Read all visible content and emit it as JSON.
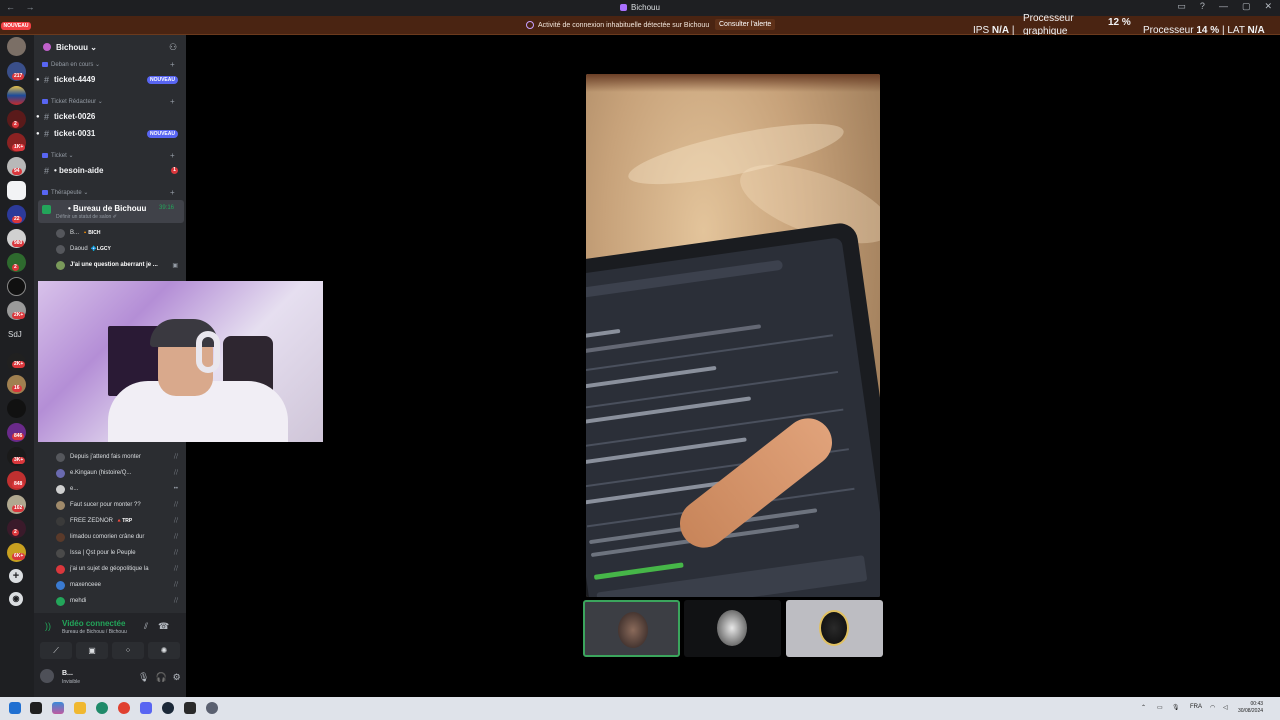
{
  "window": {
    "title": "Bichouu",
    "nav_arrows": "← →"
  },
  "alert": {
    "message": "Activité de connexion inhabituelle détectée sur Bichouu",
    "action": "Consulter l'alerte"
  },
  "overlay": {
    "ips_label": "IPS",
    "ips_value": "N/A",
    "gpu_label_1": "Processeur",
    "gpu_label_2": "graphique",
    "gpu_value": "12 %",
    "cpu_label": "Processeur",
    "cpu_value": "14 %",
    "lat_label": "LAT",
    "lat_value": "N/A",
    "sep": "|"
  },
  "rail": {
    "nouveau": "NOUVEAU",
    "sdj": "SdJ",
    "badges": [
      "217",
      "2",
      "1K+",
      "94",
      "22",
      "980",
      "2",
      "2K+",
      "2K+",
      "16",
      "846",
      "3K+",
      "848",
      "102",
      "2",
      "6K+"
    ]
  },
  "server": {
    "name": "Bichouu ⌄"
  },
  "categories": [
    {
      "label": "Deban en cours ⌄"
    },
    {
      "label": "Ticket Rédacteur ⌄"
    },
    {
      "label": "Ticket ⌄"
    },
    {
      "label": "Thérapeute ⌄"
    }
  ],
  "channels": [
    {
      "name": "ticket-4449",
      "pill": "NOUVEAU"
    },
    {
      "name": "ticket-0026",
      "pill": ""
    },
    {
      "name": "ticket-0031",
      "pill": "NOUVEAU"
    },
    {
      "name": "• besoin-aide",
      "pill": "1"
    }
  ],
  "voice_channel": {
    "name": "• Bureau de Bichouu",
    "time": "39:16",
    "status": "Définir un statut de salon ✐"
  },
  "voice_users": [
    {
      "name": "B...",
      "tag": "🔸BICH",
      "icon": ""
    },
    {
      "name": "Daoud",
      "tag": "💠LGCY",
      "icon": ""
    },
    {
      "name": "J'ai une question aberrant je ...",
      "tag": "",
      "icon": "▣"
    },
    {
      "name": "Depuis j'attend fais monter",
      "tag": "",
      "icon": "⧸⧸"
    },
    {
      "name": "e.Kingaun (histoire/Q...",
      "tag": "",
      "icon": "⧸⧸"
    },
    {
      "name": "e...",
      "tag": "",
      "icon": "••"
    },
    {
      "name": "Faut sucer pour monter ??",
      "tag": "",
      "icon": "⧸⧸"
    },
    {
      "name": "FREE ZEDNOR",
      "tag": "🔺TRP",
      "icon": "⧸⧸"
    },
    {
      "name": "limadou comorien crâne dur",
      "tag": "",
      "icon": "⧸⧸"
    },
    {
      "name": "Issa | Qst pour le Peuple",
      "tag": "",
      "icon": "⧸⧸"
    },
    {
      "name": "j'ai un sujet de géopolitique la",
      "tag": "",
      "icon": "⧸⧸"
    },
    {
      "name": "maxenceee",
      "tag": "",
      "icon": "⧸⧸"
    },
    {
      "name": "mehdi",
      "tag": "",
      "icon": "⧸⧸"
    }
  ],
  "voice_panel": {
    "status": "Vidéo connectée",
    "location": "Bureau de Bichouu / Bichouu",
    "buttons": [
      "⟋",
      "▣",
      "⁘",
      "✺"
    ]
  },
  "user_panel": {
    "name": "B...",
    "status": "Invisible"
  },
  "taskbar": {
    "lang": "FRA",
    "time": "00:43",
    "date": "30/08/2024"
  }
}
